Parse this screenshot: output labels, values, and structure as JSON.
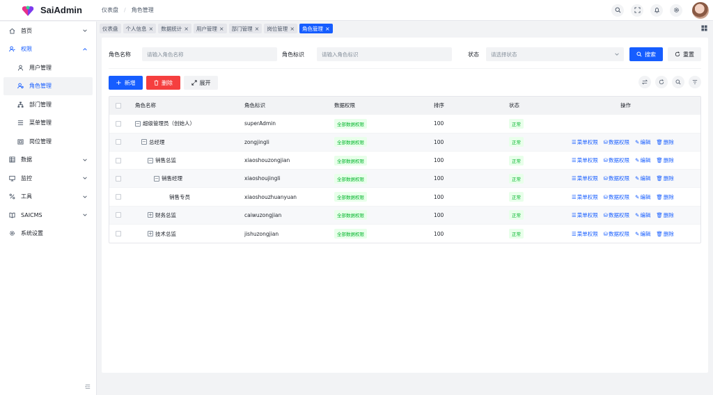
{
  "app": {
    "name": "SaiAdmin"
  },
  "breadcrumb": [
    "仪表盘",
    "角色管理"
  ],
  "sidebar": {
    "items": [
      {
        "label": "首页",
        "icon": "home-icon"
      },
      {
        "label": "权限",
        "icon": "user-key-icon"
      },
      {
        "label": "用户管理",
        "icon": "user-icon"
      },
      {
        "label": "角色管理",
        "icon": "role-icon"
      },
      {
        "label": "部门管理",
        "icon": "org-icon"
      },
      {
        "label": "菜单管理",
        "icon": "menu-icon"
      },
      {
        "label": "岗位管理",
        "icon": "post-icon"
      },
      {
        "label": "数据",
        "icon": "data-icon"
      },
      {
        "label": "监控",
        "icon": "monitor-icon"
      },
      {
        "label": "工具",
        "icon": "tool-icon"
      },
      {
        "label": "SAICMS",
        "icon": "book-icon"
      },
      {
        "label": "系统设置",
        "icon": "gear-icon"
      }
    ]
  },
  "tabs": [
    {
      "label": "仪表盘",
      "closable": false
    },
    {
      "label": "个人信息",
      "closable": true
    },
    {
      "label": "数据统计",
      "closable": true
    },
    {
      "label": "用户管理",
      "closable": true
    },
    {
      "label": "部门管理",
      "closable": true
    },
    {
      "label": "岗位管理",
      "closable": true
    },
    {
      "label": "角色管理",
      "closable": true,
      "active": true
    }
  ],
  "search": {
    "name_label": "角色名称",
    "name_placeholder": "请输入角色名称",
    "code_label": "角色标识",
    "code_placeholder": "请输入角色标识",
    "status_label": "状态",
    "status_placeholder": "请选择状态",
    "search_btn": "搜索",
    "reset_btn": "重置"
  },
  "toolbar": {
    "add": "新增",
    "delete": "删除",
    "expand": "展开"
  },
  "table": {
    "headers": [
      "角色名称",
      "角色标识",
      "数据权限",
      "排序",
      "状态",
      "操作"
    ],
    "rows": [
      {
        "name": "超级管理员（创始人）",
        "code": "superAdmin",
        "scope": "全部数据权限",
        "sort": "100",
        "status": "正常",
        "level": 0,
        "toggle": "−",
        "actions": false
      },
      {
        "name": "总经理",
        "code": "zongjingli",
        "scope": "全部数据权限",
        "sort": "100",
        "status": "正常",
        "level": 1,
        "toggle": "−",
        "actions": true
      },
      {
        "name": "销售总监",
        "code": "xiaoshouzongjian",
        "scope": "全部数据权限",
        "sort": "100",
        "status": "正常",
        "level": 2,
        "toggle": "−",
        "actions": true
      },
      {
        "name": "销售经理",
        "code": "xiaoshoujingli",
        "scope": "全部数据权限",
        "sort": "100",
        "status": "正常",
        "level": 3,
        "toggle": "−",
        "actions": true
      },
      {
        "name": "销售专员",
        "code": "xiaoshouzhuanyuan",
        "scope": "全部数据权限",
        "sort": "100",
        "status": "正常",
        "level": 4,
        "toggle": "",
        "actions": true
      },
      {
        "name": "财务总监",
        "code": "caiwuzongjian",
        "scope": "全部数据权限",
        "sort": "100",
        "status": "正常",
        "level": 2,
        "toggle": "+",
        "actions": true
      },
      {
        "name": "技术总监",
        "code": "jishuzongjian",
        "scope": "全部数据权限",
        "sort": "100",
        "status": "正常",
        "level": 2,
        "toggle": "+",
        "actions": true
      }
    ],
    "action_labels": {
      "menu": "菜单权限",
      "data": "数据权限",
      "edit": "编辑",
      "del": "删除"
    }
  },
  "colors": {
    "primary": "#165dff",
    "danger": "#f53f3f",
    "success": "#00b42a"
  }
}
